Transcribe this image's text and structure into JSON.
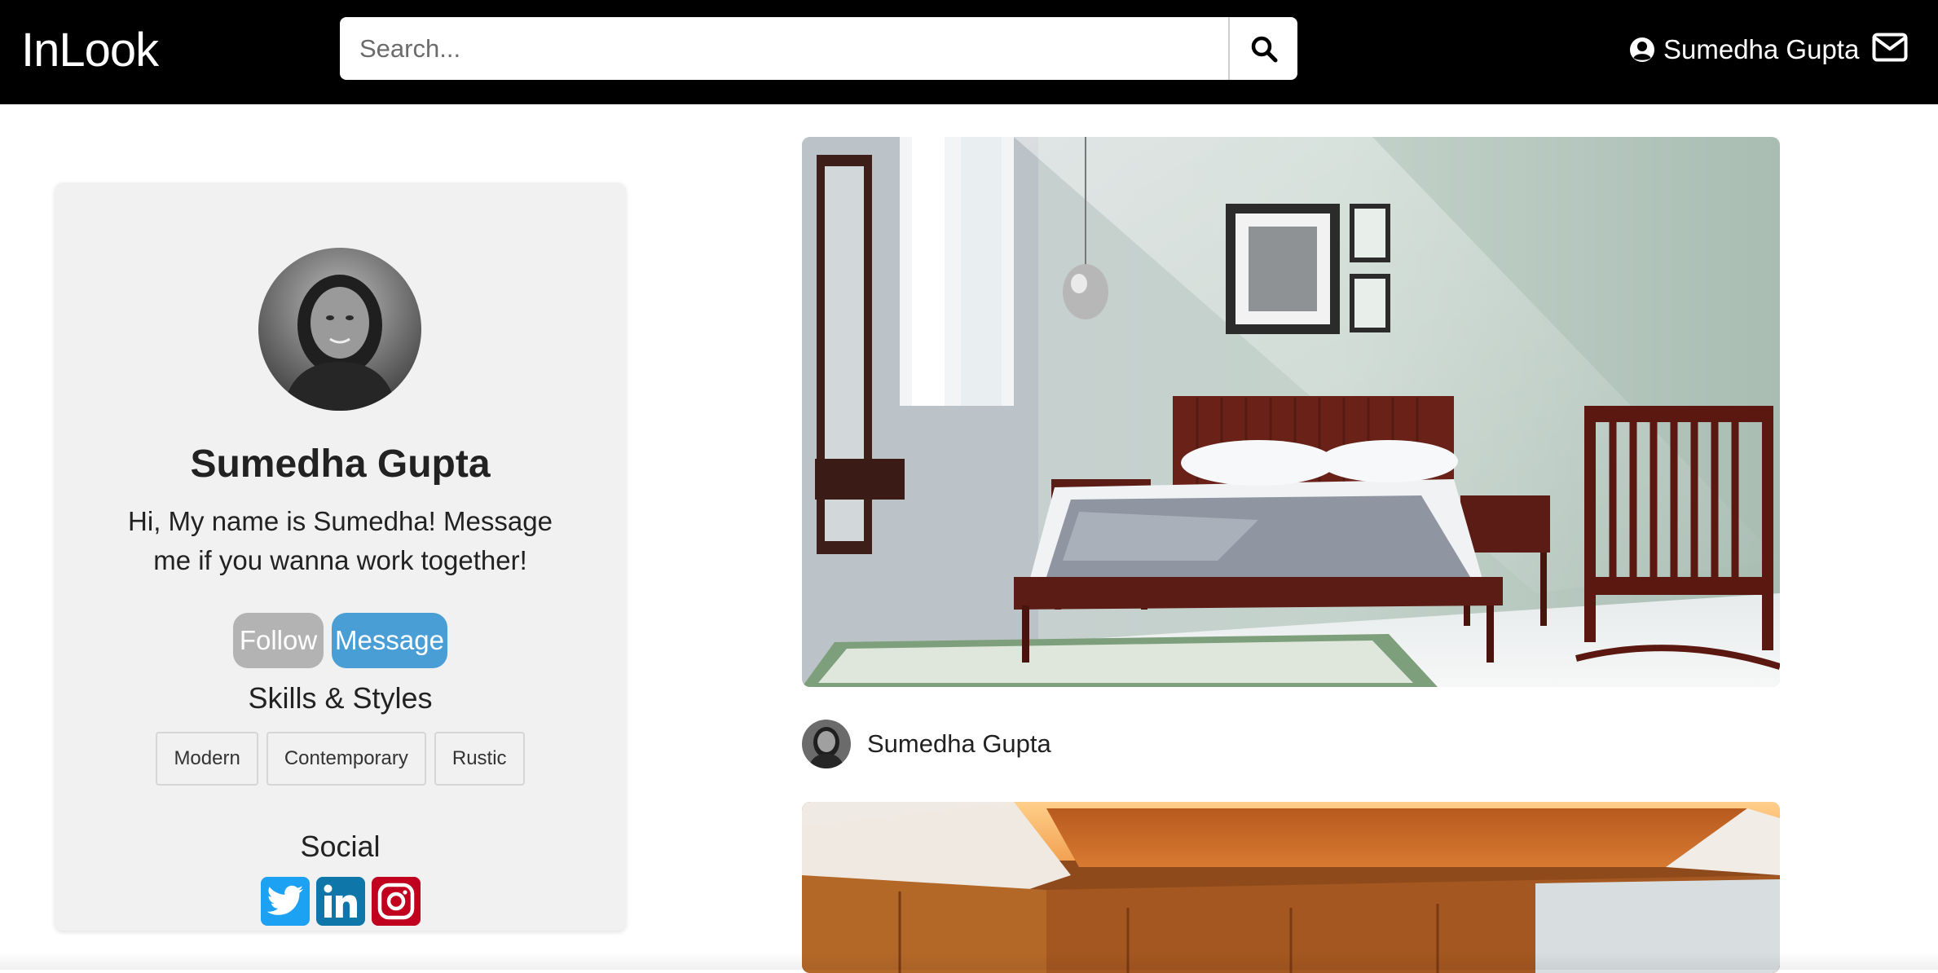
{
  "navbar": {
    "brand": "InLook",
    "search": {
      "placeholder": "Search...",
      "value": ""
    },
    "user_name": "Sumedha Gupta",
    "icons": {
      "search": "search-icon",
      "user": "user-circle-icon",
      "mail": "envelope-icon"
    }
  },
  "profile": {
    "name": "Sumedha Gupta",
    "bio": "Hi, My name is Sumedha! Message me if you wanna work together!",
    "buttons": {
      "follow": "Follow",
      "message": "Message"
    },
    "skills_title": "Skills & Styles",
    "skills": [
      "Modern",
      "Contemporary",
      "Rustic"
    ],
    "social_title": "Social",
    "social": [
      {
        "name": "twitter-icon",
        "color": "#1da1f2"
      },
      {
        "name": "linkedin-icon",
        "color": "#0e76a8"
      },
      {
        "name": "instagram-icon",
        "color": "#c1001f"
      }
    ]
  },
  "feed": {
    "posts": [
      {
        "author": "Sumedha Gupta",
        "image": "bedroom-photo"
      },
      {
        "author": "",
        "image": "wood-ceiling-room-photo"
      }
    ]
  },
  "colors": {
    "navbar": "#000000",
    "card_bg": "#f1f1f1",
    "follow": "#b3b3b3",
    "message": "#4a9ed6"
  }
}
